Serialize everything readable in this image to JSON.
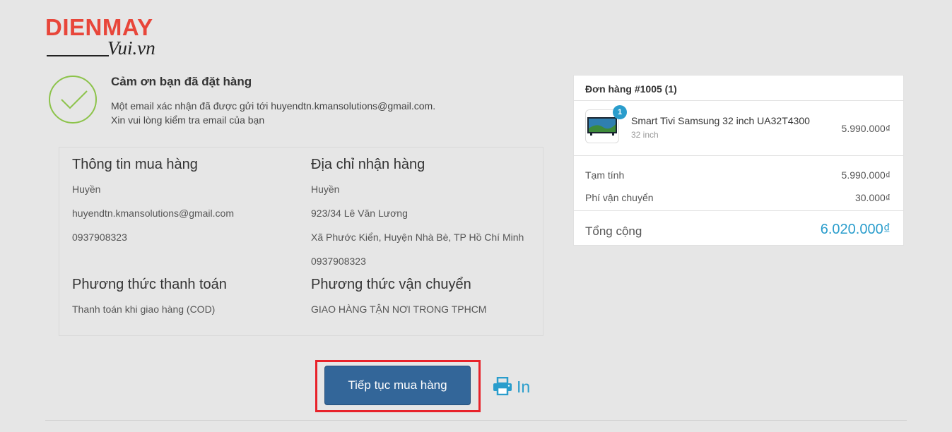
{
  "logo": {
    "brand": "DIENMAY",
    "sub": "Vui.vn"
  },
  "thanks": {
    "title": "Cảm ơn bạn đã đặt hàng",
    "line1": "Một email xác nhận đã được gửi tới huyendtn.kmansolutions@gmail.com.",
    "line2": "Xin vui lòng kiểm tra email của bạn"
  },
  "buyer": {
    "heading": "Thông tin mua hàng",
    "name": "Huyền",
    "email": "huyendtn.kmansolutions@gmail.com",
    "phone": "0937908323"
  },
  "shipping_address": {
    "heading": "Địa chỉ nhận hàng",
    "name": "Huyền",
    "street": "923/34 Lê Văn Lương",
    "area": "Xã Phước Kiển, Huyện Nhà Bè, TP Hồ Chí Minh",
    "phone": "0937908323"
  },
  "payment": {
    "heading": "Phương thức thanh toán",
    "value": "Thanh toán khi giao hàng (COD)"
  },
  "delivery": {
    "heading": "Phương thức vận chuyển",
    "value": "GIAO HÀNG TẬN NƠI TRONG TPHCM"
  },
  "order": {
    "heading": "Đơn hàng #1005 (1)",
    "item": {
      "name": "Smart Tivi Samsung 32 inch UA32T4300",
      "variant": "32 inch",
      "quantity": "1",
      "price": "5.990.000₫"
    },
    "subtotal_label": "Tạm tính",
    "subtotal": "5.990.000₫",
    "shipping_label": "Phí vận chuyển",
    "shipping_fee": "30.000₫",
    "total_label": "Tổng cộng",
    "total": "6.020.000₫"
  },
  "actions": {
    "continue_label": "Tiếp tục mua hàng",
    "print_label": "In",
    "print_icon": "printer-icon"
  },
  "colors": {
    "accent": "#2a9dcc",
    "button": "#336699",
    "highlight": "#e8222a",
    "success": "#8cc34a",
    "brand": "#e8463a"
  }
}
